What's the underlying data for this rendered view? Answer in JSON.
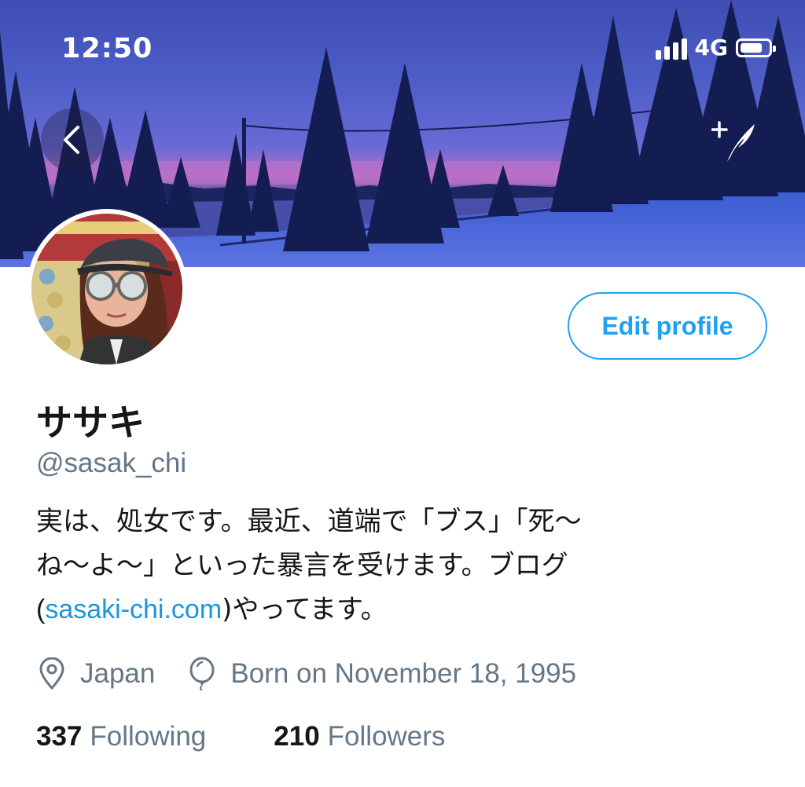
{
  "status_bar": {
    "time": "12:50",
    "network": "4G",
    "signal_bars": 4,
    "battery_level": 0.8
  },
  "header": {
    "back_icon": "chevron-left-icon",
    "compose_icon": "compose-tweet-icon"
  },
  "profile": {
    "display_name": "ササキ",
    "handle": "@sasak_chi",
    "edit_button": "Edit profile",
    "bio_line1": "実は、処女です。最近、道端で「ブス」「死〜",
    "bio_line2": "ね〜よ〜」といった暴言を受けます。ブログ",
    "bio_line3_open": "(",
    "bio_link": "sasaki-chi.com",
    "bio_line3_rest": ")やってます。",
    "location": "Japan",
    "birthday": "Born on November 18, 1995",
    "following_count": "337",
    "following_label": "Following",
    "followers_count": "210",
    "followers_label": "Followers"
  },
  "colors": {
    "accent": "#1da1f2",
    "link": "#1b95e0",
    "secondary_text": "#657786",
    "primary_text": "#14171a"
  }
}
